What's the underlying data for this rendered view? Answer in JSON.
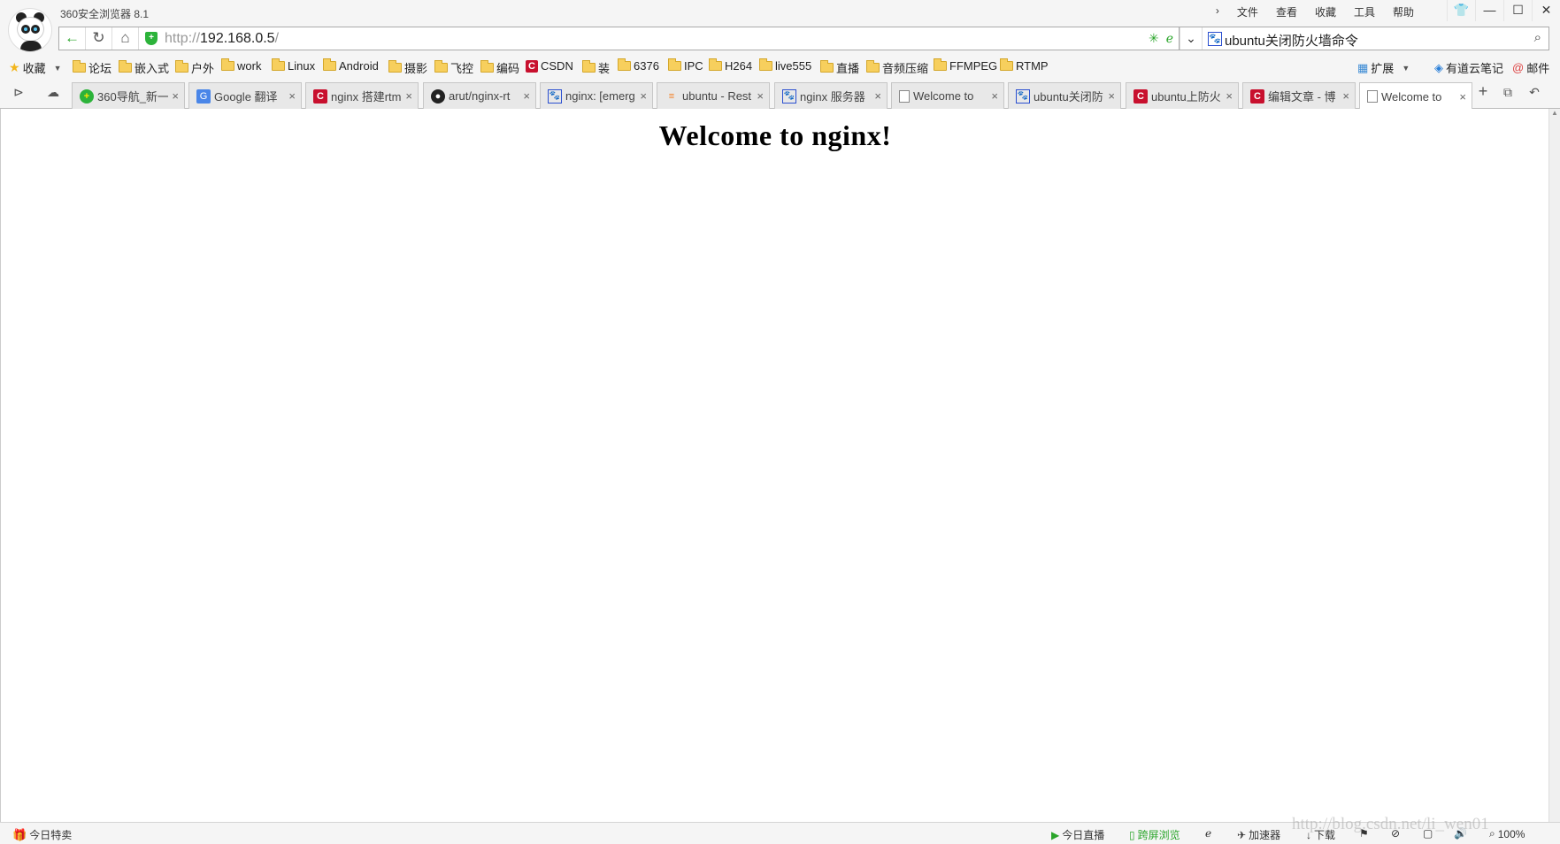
{
  "app": {
    "title": "360安全浏览器 8.1",
    "menu": [
      "文件",
      "查看",
      "收藏",
      "工具",
      "帮助"
    ],
    "window_buttons": [
      "shirt",
      "minimize",
      "maximize",
      "close"
    ]
  },
  "address_bar": {
    "url_scheme": "http://",
    "url_host": "192.168.0.5",
    "url_path": "/",
    "search_text": "ubuntu关闭防火墙命令"
  },
  "bookmarks": [
    {
      "label": "收藏",
      "icon": "star-icon"
    },
    {
      "label": "论坛",
      "icon": "folder-icon"
    },
    {
      "label": "嵌入式",
      "icon": "folder-icon"
    },
    {
      "label": "户外",
      "icon": "folder-icon"
    },
    {
      "label": "work",
      "icon": "folder-icon"
    },
    {
      "label": "Linux",
      "icon": "folder-icon"
    },
    {
      "label": "Android",
      "icon": "folder-icon"
    },
    {
      "label": "摄影",
      "icon": "folder-icon"
    },
    {
      "label": "飞控",
      "icon": "folder-icon"
    },
    {
      "label": "编码",
      "icon": "folder-icon"
    },
    {
      "label": "CSDN",
      "icon": "csdn-icon"
    },
    {
      "label": "装",
      "icon": "folder-icon"
    },
    {
      "label": "6376",
      "icon": "folder-icon"
    },
    {
      "label": "IPC",
      "icon": "folder-icon"
    },
    {
      "label": "H264",
      "icon": "folder-icon"
    },
    {
      "label": "live555",
      "icon": "folder-icon"
    },
    {
      "label": "直播",
      "icon": "folder-icon"
    },
    {
      "label": "音频压缩",
      "icon": "folder-icon"
    },
    {
      "label": "FFMPEG",
      "icon": "folder-icon"
    },
    {
      "label": "RTMP",
      "icon": "folder-icon"
    }
  ],
  "bookmark_tools": [
    {
      "label": "扩展"
    },
    {
      "label": "有道云笔记"
    },
    {
      "label": "邮件"
    }
  ],
  "tabs": [
    {
      "label": "360导航_新一",
      "icon": "360-icon"
    },
    {
      "label": "Google 翻译",
      "icon": "google-translate-icon"
    },
    {
      "label": "nginx 搭建rtm",
      "icon": "csdn-icon"
    },
    {
      "label": "arut/nginx-rt",
      "icon": "github-icon"
    },
    {
      "label": "nginx: [emerg",
      "icon": "baidu-paw-icon"
    },
    {
      "label": "ubuntu - Rest",
      "icon": "stackoverflow-icon"
    },
    {
      "label": "nginx 服务器",
      "icon": "baidu-paw-icon"
    },
    {
      "label": "Welcome to",
      "icon": "page-icon"
    },
    {
      "label": "ubuntu关闭防",
      "icon": "baidu-paw-icon"
    },
    {
      "label": "ubuntu上防火",
      "icon": "csdn-icon"
    },
    {
      "label": "编辑文章 - 博",
      "icon": "csdn-icon"
    },
    {
      "label": "Welcome to",
      "icon": "page-icon",
      "active": true
    }
  ],
  "page": {
    "heading": "Welcome to nginx!"
  },
  "status_bar": {
    "left": "今日特卖",
    "items": [
      "今日直播",
      "跨屏浏览",
      "加速器",
      "下载"
    ],
    "zoom": "100%",
    "watermark": "http://blog.csdn.net/li_wen01"
  },
  "colors": {
    "accent_green": "#2aa52a",
    "csdn_red": "#c8102e",
    "baidu_blue": "#2a4fd0"
  }
}
